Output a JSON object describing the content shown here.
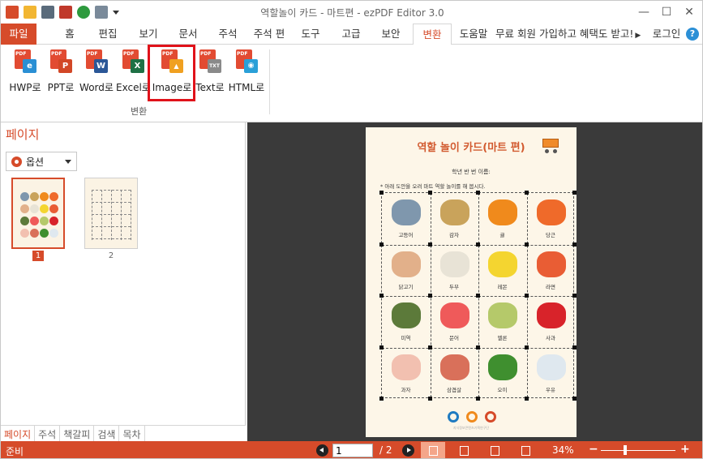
{
  "app": {
    "title": "역할놀이 카드 - 마트편 - ezPDF Editor 3.0"
  },
  "window_controls": {
    "minimize": "—",
    "maximize": "☐",
    "close": "✕"
  },
  "menu": {
    "file": "파일",
    "tabs": [
      "홈",
      "편집",
      "보기",
      "문서",
      "주석",
      "주석 편",
      "도구",
      "고급",
      "보안",
      "변환",
      "도움말"
    ],
    "active_tab": "변환",
    "promo": "무료 회원 가입하고 혜택도 받고!",
    "login": "로그인",
    "help": "?"
  },
  "ribbon": {
    "buttons": [
      {
        "label": "HWP로",
        "badge": "e",
        "color": "#2a8fd4"
      },
      {
        "label": "PPT로",
        "badge": "P",
        "color": "#d24726"
      },
      {
        "label": "Word로",
        "badge": "W",
        "color": "#2b5797"
      },
      {
        "label": "Excel로",
        "badge": "X",
        "color": "#1e7145"
      },
      {
        "label": "Image로",
        "badge": "▲",
        "color": "#f0a020"
      },
      {
        "label": "Text로",
        "badge": "TXT",
        "color": "#8a8a8a"
      },
      {
        "label": "HTML로",
        "badge": "◉",
        "color": "#2aa0d8"
      }
    ],
    "group_label": "변환",
    "pdf_tag": "PDF"
  },
  "left_panel": {
    "title": "페이지",
    "options_label": "옵션",
    "pages": [
      "1",
      "2"
    ],
    "selected_page": "1",
    "bottom_tabs": [
      "페이지",
      "주석",
      "책갈피",
      "검색",
      "목차"
    ]
  },
  "document": {
    "title": "역할 놀이 카드(마트 편)",
    "info_line": "학년   반   번   이름:",
    "instruction": "* 아래 도안을 오려 마트 역할 놀이를 해 봅시다.",
    "cards": [
      {
        "label": "고등어",
        "color": "#7f97ad"
      },
      {
        "label": "감자",
        "color": "#c9a35b"
      },
      {
        "label": "귤",
        "color": "#f08a1c"
      },
      {
        "label": "당근",
        "color": "#ef6a2a"
      },
      {
        "label": "닭고기",
        "color": "#e2b08a"
      },
      {
        "label": "두부",
        "color": "#e8e3d6"
      },
      {
        "label": "레몬",
        "color": "#f4d530"
      },
      {
        "label": "라면",
        "color": "#e95d34"
      },
      {
        "label": "미역",
        "color": "#5c7a3a"
      },
      {
        "label": "문어",
        "color": "#ef5a5a"
      },
      {
        "label": "멜론",
        "color": "#b5c96a"
      },
      {
        "label": "사과",
        "color": "#d8232a"
      },
      {
        "label": "과자",
        "color": "#f2c0b0"
      },
      {
        "label": "삼겹살",
        "color": "#d9705a"
      },
      {
        "label": "오이",
        "color": "#3f8f2f"
      },
      {
        "label": "우유",
        "color": "#dfe8ef"
      }
    ],
    "footer_logo": "오아오",
    "footer_text": "지식정보콘텐츠기획연구단"
  },
  "status": {
    "ready": "준비",
    "current_page": "1",
    "total_pages": "/ 2",
    "zoom": "34%",
    "zoom_minus": "−",
    "zoom_plus": "+"
  }
}
